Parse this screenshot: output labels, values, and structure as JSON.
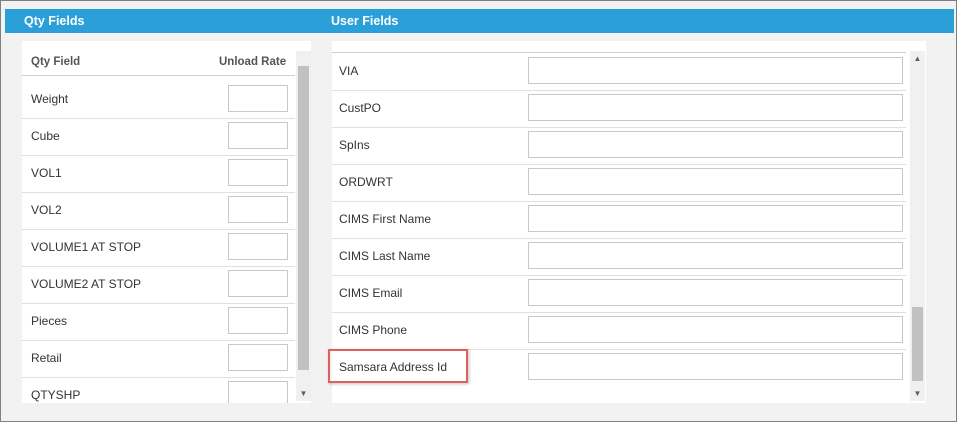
{
  "header": {
    "qty_title": "Qty Fields",
    "user_title": "User Fields"
  },
  "qty": {
    "col_field": "Qty Field",
    "col_rate": "Unload Rate",
    "rows": [
      {
        "label": "Weight",
        "value": ""
      },
      {
        "label": "Cube",
        "value": ""
      },
      {
        "label": "VOL1",
        "value": ""
      },
      {
        "label": "VOL2",
        "value": ""
      },
      {
        "label": "VOLUME1 AT STOP",
        "value": ""
      },
      {
        "label": "VOLUME2 AT STOP",
        "value": ""
      },
      {
        "label": "Pieces",
        "value": ""
      },
      {
        "label": "Retail",
        "value": ""
      },
      {
        "label": "QTYSHP",
        "value": ""
      }
    ]
  },
  "user": {
    "rows": [
      {
        "label": "VIA",
        "value": ""
      },
      {
        "label": "CustPO",
        "value": ""
      },
      {
        "label": "SpIns",
        "value": ""
      },
      {
        "label": "ORDWRT",
        "value": ""
      },
      {
        "label": "CIMS First Name",
        "value": ""
      },
      {
        "label": "CIMS Last Name",
        "value": ""
      },
      {
        "label": "CIMS Email",
        "value": ""
      },
      {
        "label": "CIMS Phone",
        "value": ""
      },
      {
        "label": "Samsara Address Id",
        "value": ""
      }
    ]
  },
  "icons": {
    "scroll_up": "▲",
    "scroll_down": "▼"
  },
  "colors": {
    "header_bar": "#2a9fd8",
    "highlight": "#e0605e"
  }
}
